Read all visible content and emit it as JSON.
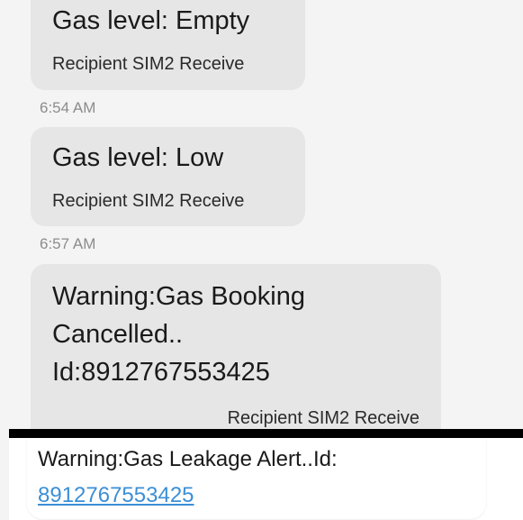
{
  "messages": [
    {
      "text": "Gas level: Empty",
      "sim_label": "Recipient SIM2 Receive"
    },
    {
      "text": "Gas level: Low",
      "sim_label": "Recipient SIM2 Receive"
    },
    {
      "text": "Warning:Gas Booking Cancelled.. Id:8912767553425",
      "sim_label": "Recipient SIM2 Receive"
    },
    {
      "text": "Warning:Gas Leakage Alert..Id:",
      "link": "8912767553425"
    }
  ],
  "timestamps": [
    "6:54 AM",
    "6:57 AM"
  ],
  "colors": {
    "bubble_background": "#e6e6e6",
    "link": "#3b8fd6",
    "timestamp": "#8c8c8c"
  }
}
